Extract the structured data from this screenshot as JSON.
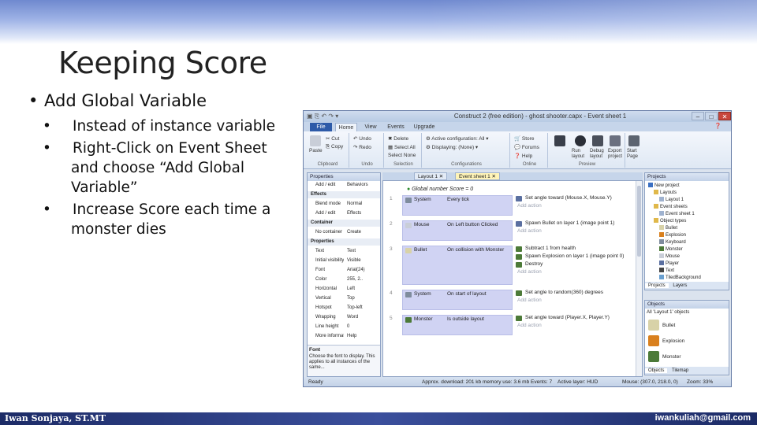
{
  "slide": {
    "title": "Keeping Score",
    "bullet_main": "Add Global Variable",
    "sub_bullets": [
      "Instead of instance variable",
      "Right-Click on Event Sheet and choose “Add Global Variable”",
      "Increase Score each time a monster dies"
    ],
    "footer_left": "Iwan Sonjaya, ST.MT",
    "footer_right": "iwankuliah@gmail.com",
    "bullet_glyph": "•"
  },
  "app": {
    "title": "Construct 2 (free edition) - ghost shooter.capx - Event sheet 1",
    "ribbon_tabs": [
      "File",
      "Home",
      "View",
      "Events",
      "Upgrade"
    ],
    "ribbon_groups": {
      "clipboard": {
        "label": "Clipboard",
        "items": [
          "Cut",
          "Copy",
          "Paste"
        ]
      },
      "undo": {
        "label": "Undo",
        "items": [
          "Undo",
          "Redo"
        ]
      },
      "selection": {
        "label": "Selection",
        "items": [
          "Delete",
          "Select All",
          "Select None"
        ]
      },
      "configurations": {
        "label": "Configurations",
        "items": [
          "Active configuration: All",
          "Displaying: (None)"
        ]
      },
      "online": {
        "label": "Online",
        "items": [
          "Store",
          "Forums",
          "Help"
        ]
      },
      "preview": {
        "label": "Preview",
        "items": [
          "Run layout",
          "Debug layout",
          "Export project"
        ]
      },
      "start": {
        "label": "Start Page",
        "items": [
          "Start Page"
        ]
      }
    },
    "properties": {
      "header": "Properties",
      "rows": [
        {
          "k": "Add / edit",
          "v": "Behaviors"
        },
        {
          "cat": "Effects"
        },
        {
          "k": "Blend mode",
          "v": "Normal"
        },
        {
          "k": "Add / edit",
          "v": "Effects"
        },
        {
          "cat": "Container"
        },
        {
          "k": "No container",
          "v": "Create"
        },
        {
          "cat": "Properties"
        },
        {
          "k": "Text",
          "v": "Text"
        },
        {
          "k": "Initial visibility",
          "v": "Visible"
        },
        {
          "k": "Font",
          "v": "Arial(24)"
        },
        {
          "k": "Color",
          "v": "255, 2.."
        },
        {
          "k": "Horizontal",
          "v": "Left"
        },
        {
          "k": "Vertical",
          "v": "Top"
        },
        {
          "k": "Hotspot",
          "v": "Top-left"
        },
        {
          "k": "Wrapping",
          "v": "Word"
        },
        {
          "k": "Line height",
          "v": "0"
        },
        {
          "k": "More information",
          "v": "Help"
        }
      ],
      "help_title": "Font",
      "help_text": "Choose the font to display. This applies to all instances of the same..."
    },
    "sheet_tabs": [
      "Layout 1",
      "Event sheet 1"
    ],
    "global_var": "Global number Score = 0",
    "events": [
      {
        "num": "1",
        "object": "System",
        "condition": "Every tick",
        "actions": [
          "Set angle toward (Mouse.X, Mouse.Y)"
        ],
        "actor": "Player"
      },
      {
        "num": "2",
        "object": "Mouse",
        "condition": "On Left button Clicked",
        "actions": [
          "Spawn Bullet on layer 1 (image point 1)"
        ],
        "actor": "Player"
      },
      {
        "num": "3",
        "object": "Bullet",
        "condition": "On collision with Monster",
        "actions": [
          "Subtract 1 from health",
          "Spawn Explosion on layer 1 (image point 0)",
          "Destroy"
        ],
        "actor": "Monster"
      },
      {
        "num": "4",
        "object": "System",
        "condition": "On start of layout",
        "actions": [
          "Set angle to random(360) degrees"
        ],
        "actor": "Monster"
      },
      {
        "num": "5",
        "object": "Monster",
        "condition": "Is outside layout",
        "actions": [
          "Set angle toward (Player.X, Player.Y)"
        ],
        "actor": "Monster"
      }
    ],
    "add_action": "Add action",
    "projects": {
      "header": "Projects",
      "items": [
        "New project",
        "Layouts",
        "Layout 1",
        "Event sheets",
        "Event sheet 1",
        "Object types",
        "Bullet",
        "Explosion",
        "Keyboard",
        "Monster",
        "Mouse",
        "Player",
        "Text",
        "TiledBackground"
      ],
      "tabs": [
        "Projects",
        "Layers"
      ]
    },
    "objects": {
      "header": "Objects",
      "filter": "All 'Layout 1' objects",
      "items": [
        "Bullet",
        "Explosion",
        "Monster"
      ],
      "tabs": [
        "Objects",
        "Tilemap"
      ]
    },
    "status": [
      "Ready",
      "Approx. download: 201 kb  memory use: 3.6 mb  Events: 7",
      "Active layer: HUD",
      "Mouse: (307.0, 218.0, 0)",
      "Zoom: 33%"
    ],
    "colors": {
      "accent": "#2d5aa8",
      "condition": "#d0d3f3",
      "active_tab": "#fff4b8"
    }
  }
}
